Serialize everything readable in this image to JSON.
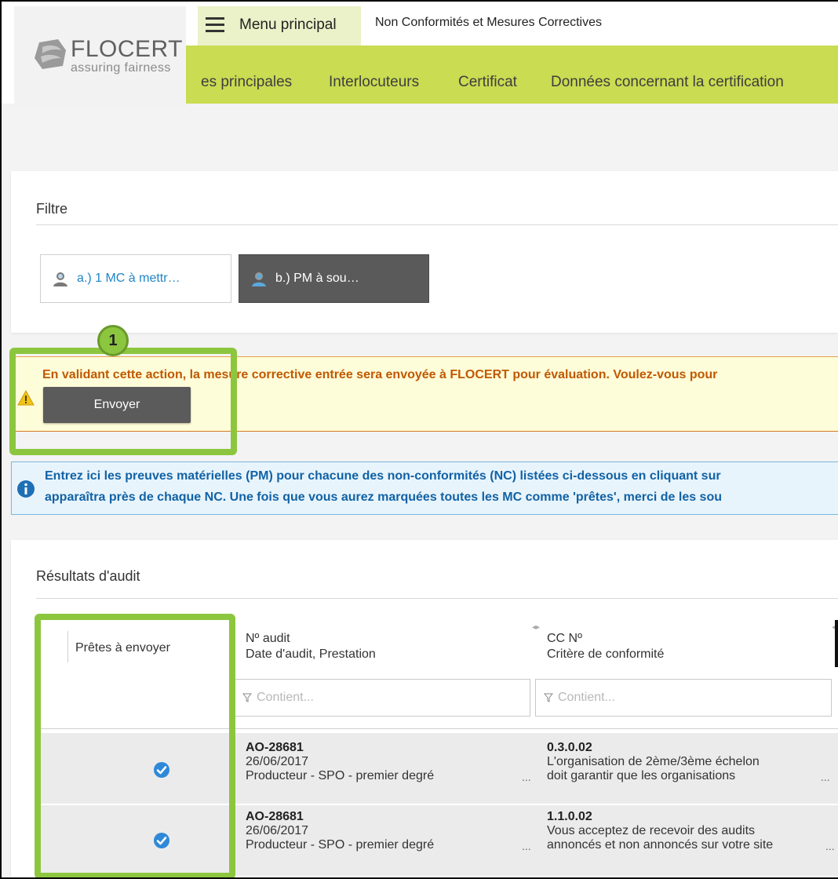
{
  "header": {
    "logo": {
      "name": "FLOCERT",
      "tagline": "assuring fairness"
    },
    "menu_label": "Menu principal",
    "page_title": "Non Conformités et Mesures Correctives"
  },
  "nav": {
    "items": [
      {
        "label": "es principales"
      },
      {
        "label": "Interlocuteurs"
      },
      {
        "label": "Certificat"
      },
      {
        "label": "Données concernant la certification"
      }
    ]
  },
  "filter": {
    "title": "Filtre",
    "buttons": [
      {
        "label": "a.) 1 MC à mettr…"
      },
      {
        "label": "b.) PM à sou…"
      }
    ]
  },
  "warning": {
    "text": "En validant cette action, la mesure corrective entrée sera envoyée à FLOCERT pour évaluation. Voulez-vous pour",
    "button": "Envoyer"
  },
  "info": {
    "line1": "Entrez ici les preuves matérielles (PM) pour chacune des non-conformités (NC) listées ci-dessous en cliquant sur",
    "line2": "apparaîtra près de chaque NC. Une fois que vous aurez marquées toutes les MC comme 'prêtes', merci de les sou"
  },
  "results": {
    "title": "Résultats d'audit",
    "columns": {
      "ready": "Prêtes à envoyer",
      "audit_line1": "Nº audit",
      "audit_line2": "Date d'audit, Prestation",
      "cc_line1": "CC Nº",
      "cc_line2": "Critère de conformité"
    },
    "filter_placeholder": "Contient...",
    "rows": [
      {
        "audit_no": "AO-28681",
        "date": "26/06/2017",
        "service": "Producteur - SPO - premier degré",
        "cc_no": "0.3.0.02",
        "criterion_line1": "L'organisation de 2ème/3ème échelon",
        "criterion_line2": "doit garantir que les organisations"
      },
      {
        "audit_no": "AO-28681",
        "date": "26/06/2017",
        "service": "Producteur - SPO - premier degré",
        "cc_no": "1.1.0.02",
        "criterion_line1": "Vous acceptez de recevoir des audits",
        "criterion_line2": "annoncés et non annoncés sur votre site"
      }
    ]
  },
  "annotation": {
    "step": "1"
  },
  "colors": {
    "brand_green": "#c9dc52",
    "highlight_green": "#8cc63f",
    "warning_text": "#c15800",
    "info_text": "#1162a6",
    "link_blue": "#1f86c7"
  }
}
